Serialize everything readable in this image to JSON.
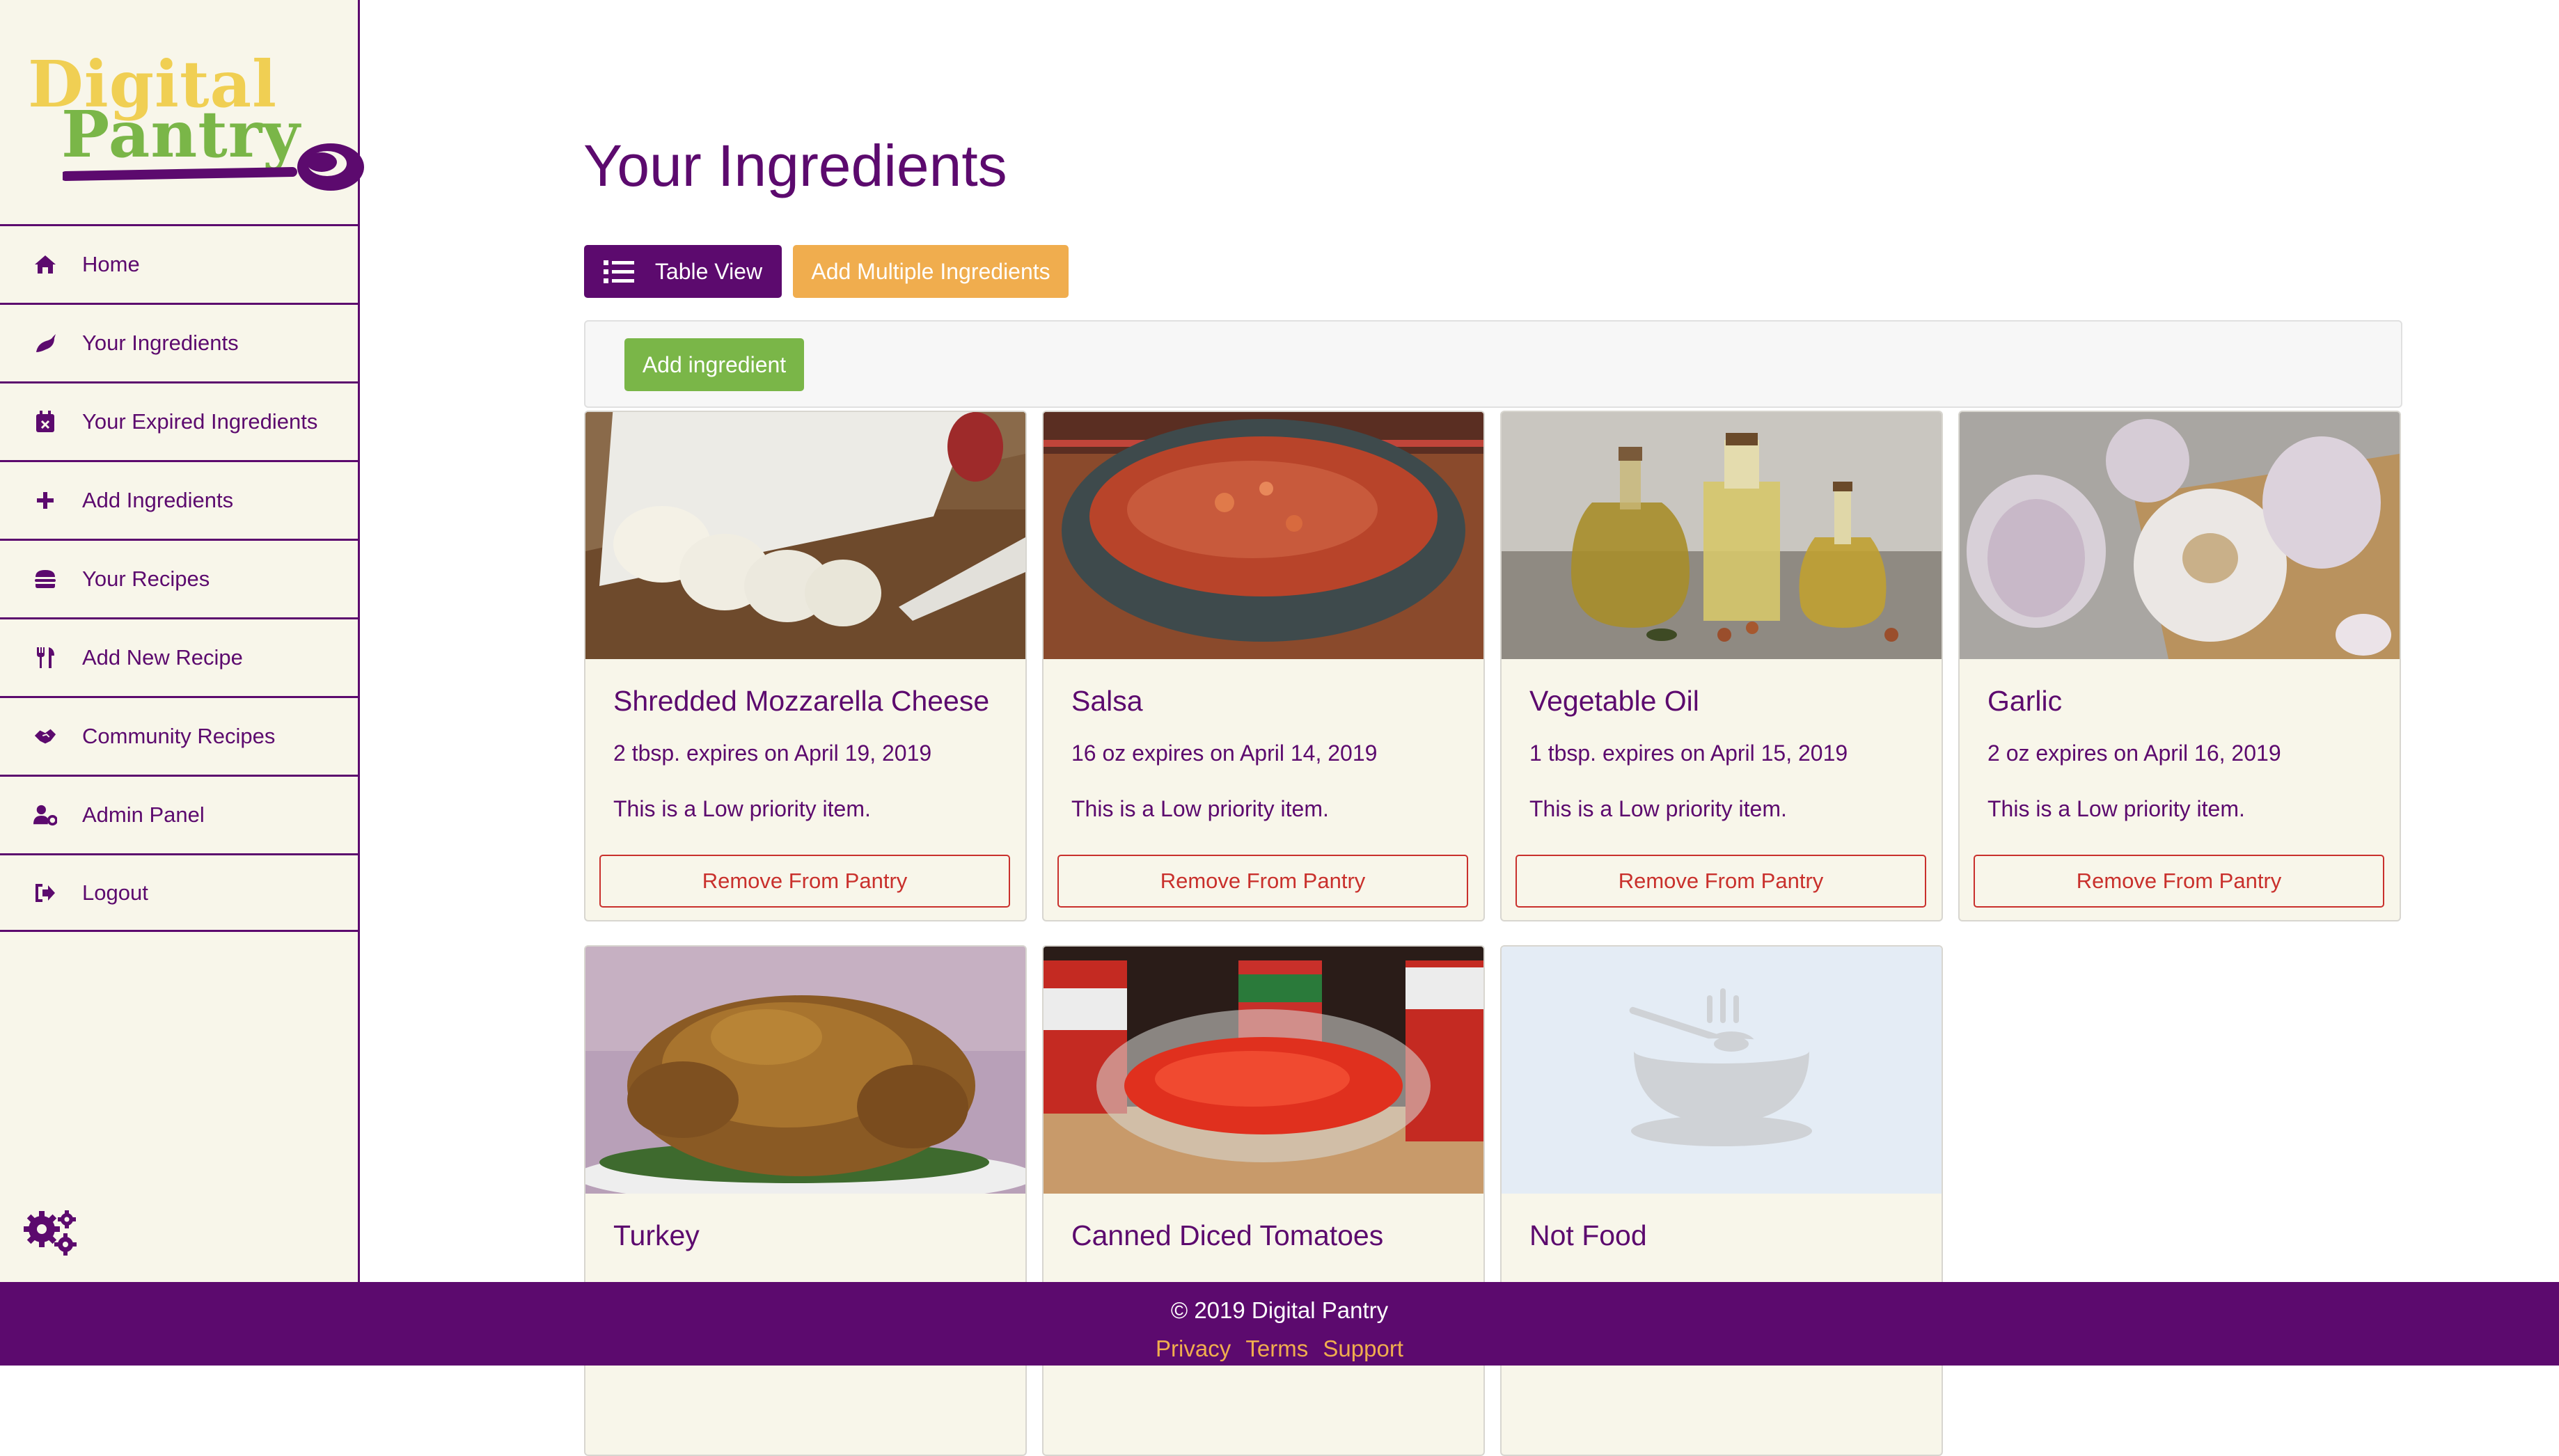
{
  "sidebar": {
    "logo": {
      "line1": "Digital",
      "line2": "Pantry"
    },
    "items": [
      {
        "label": "Home",
        "icon": "home-icon"
      },
      {
        "label": "Your Ingredients",
        "icon": "pepper-icon"
      },
      {
        "label": "Your Expired Ingredients",
        "icon": "calendar-x-icon"
      },
      {
        "label": "Add Ingredients",
        "icon": "plus-icon"
      },
      {
        "label": "Your Recipes",
        "icon": "burger-icon"
      },
      {
        "label": "Add New Recipe",
        "icon": "utensils-icon"
      },
      {
        "label": "Community Recipes",
        "icon": "handshake-icon"
      },
      {
        "label": "Admin Panel",
        "icon": "user-cog-icon"
      },
      {
        "label": "Logout",
        "icon": "sign-out-icon"
      }
    ],
    "settings_icon": "cogs-icon"
  },
  "main": {
    "title": "Your Ingredients",
    "table_view_label": "Table View",
    "add_multiple_label": "Add Multiple Ingredients",
    "add_ingredient_label": "Add ingredient"
  },
  "cards": [
    {
      "title": "Shredded Mozzarella Cheese",
      "qty": "2 tbsp. expires on April 19, 2019",
      "priority": "This is a Low priority item.",
      "remove_label": "Remove From Pantry",
      "image": "sliced-mozzarella-photo"
    },
    {
      "title": "Salsa",
      "qty": "16 oz expires on April 14, 2019",
      "priority": "This is a Low priority item.",
      "remove_label": "Remove From Pantry",
      "image": "salsa-bowl-photo"
    },
    {
      "title": "Vegetable Oil",
      "qty": "1 tbsp. expires on April 15, 2019",
      "priority": "This is a Low priority item.",
      "remove_label": "Remove From Pantry",
      "image": "oil-bottles-photo"
    },
    {
      "title": "Garlic",
      "qty": "2 oz expires on April 16, 2019",
      "priority": "This is a Low priority item.",
      "remove_label": "Remove From Pantry",
      "image": "garlic-bulbs-photo"
    },
    {
      "title": "Turkey",
      "image": "roast-turkey-photo"
    },
    {
      "title": "Canned Diced Tomatoes",
      "image": "diced-tomatoes-photo"
    },
    {
      "title": "Not Food",
      "image": "placeholder-bowl-icon"
    }
  ],
  "footer": {
    "copyright": "© 2019 Digital Pantry",
    "links": [
      "Privacy",
      "Terms",
      "Support"
    ]
  },
  "colors": {
    "brand_purple": "#5c0a6e",
    "accent_orange": "#f0ad4e",
    "accent_green": "#7ab648",
    "logo_yellow": "#f0cf53",
    "danger_red": "#c9302c",
    "sidebar_bg": "#f8f6ea"
  }
}
